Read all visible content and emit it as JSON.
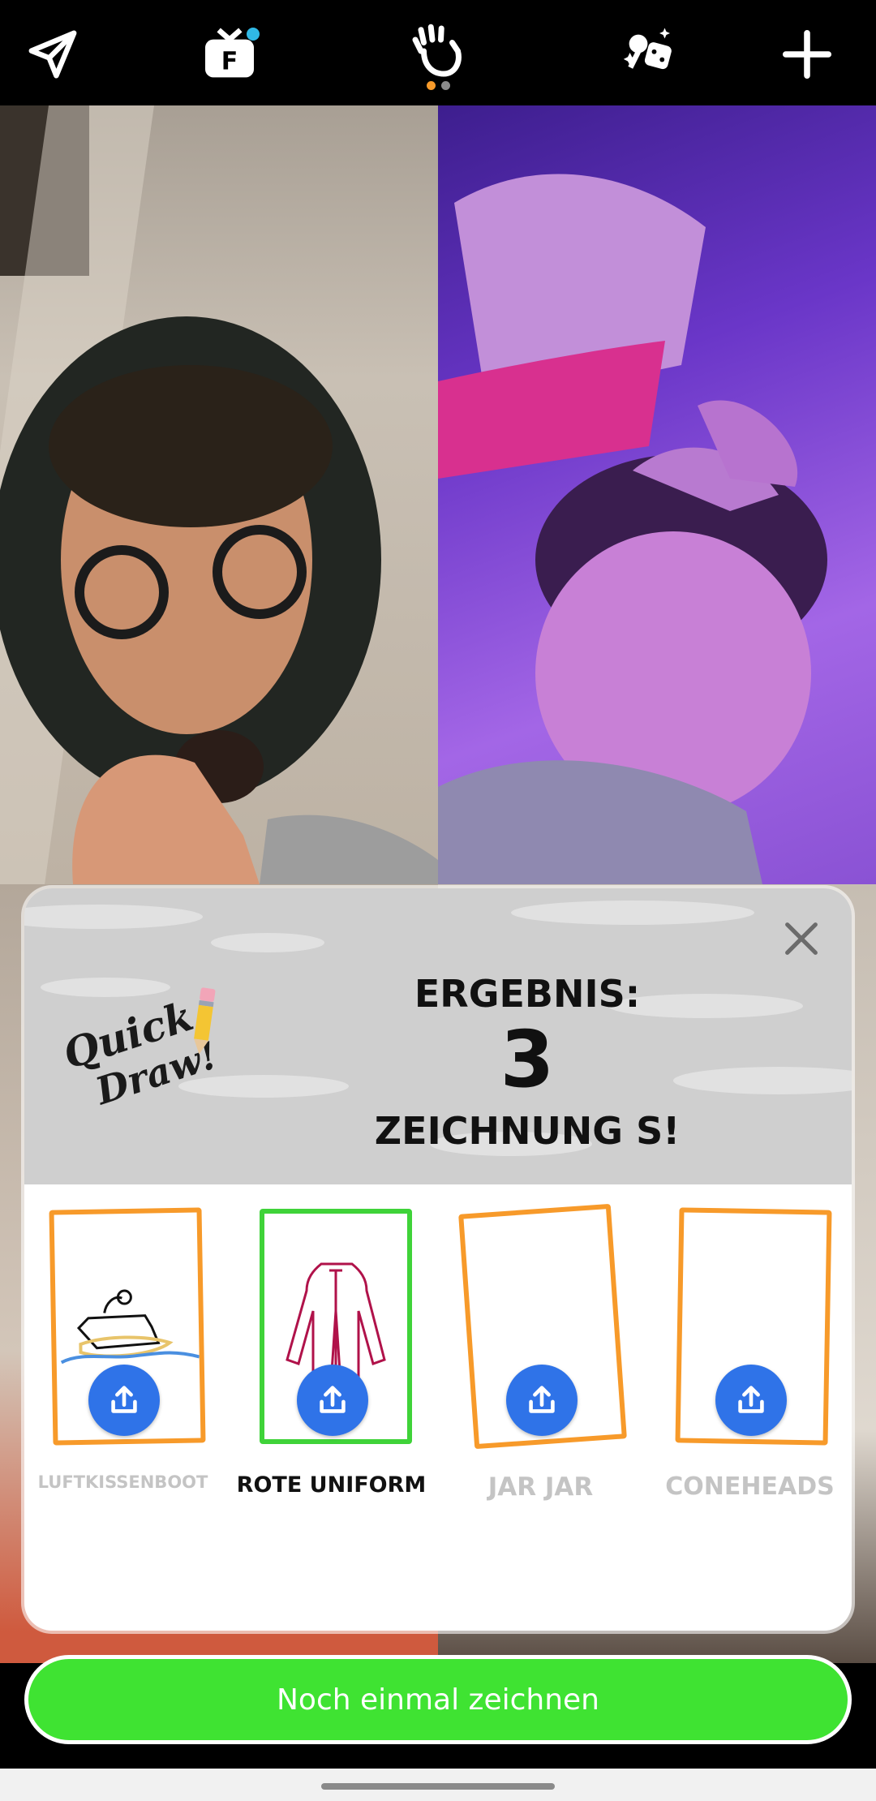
{
  "result": {
    "heading": "ERGEBNIS:",
    "count": "3",
    "subtitle": "ZEICHNUNG S!"
  },
  "logo_text": "Quick Draw!",
  "drawings": [
    {
      "label": "LUFTKISSENBOOT",
      "status": "not-guessed"
    },
    {
      "label": "ROTE UNIFORM",
      "status": "guessed"
    },
    {
      "label": "JAR JAR",
      "status": "not-guessed"
    },
    {
      "label": "CONEHEADS",
      "status": "not-guessed"
    }
  ],
  "action": {
    "draw_again": "Noch einmal zeichnen"
  },
  "topbar": {
    "icons": [
      "send-icon",
      "tv-f-icon",
      "wave-hand-icon",
      "games-icon",
      "plus-icon"
    ],
    "pager_dots": 2,
    "active_dot": 1
  },
  "colors": {
    "accent_green": "#3fe332",
    "card_orange": "#f79a2a",
    "card_green": "#3fd339",
    "share_blue": "#2f73e8",
    "notification_dot": "#30b9e6"
  }
}
